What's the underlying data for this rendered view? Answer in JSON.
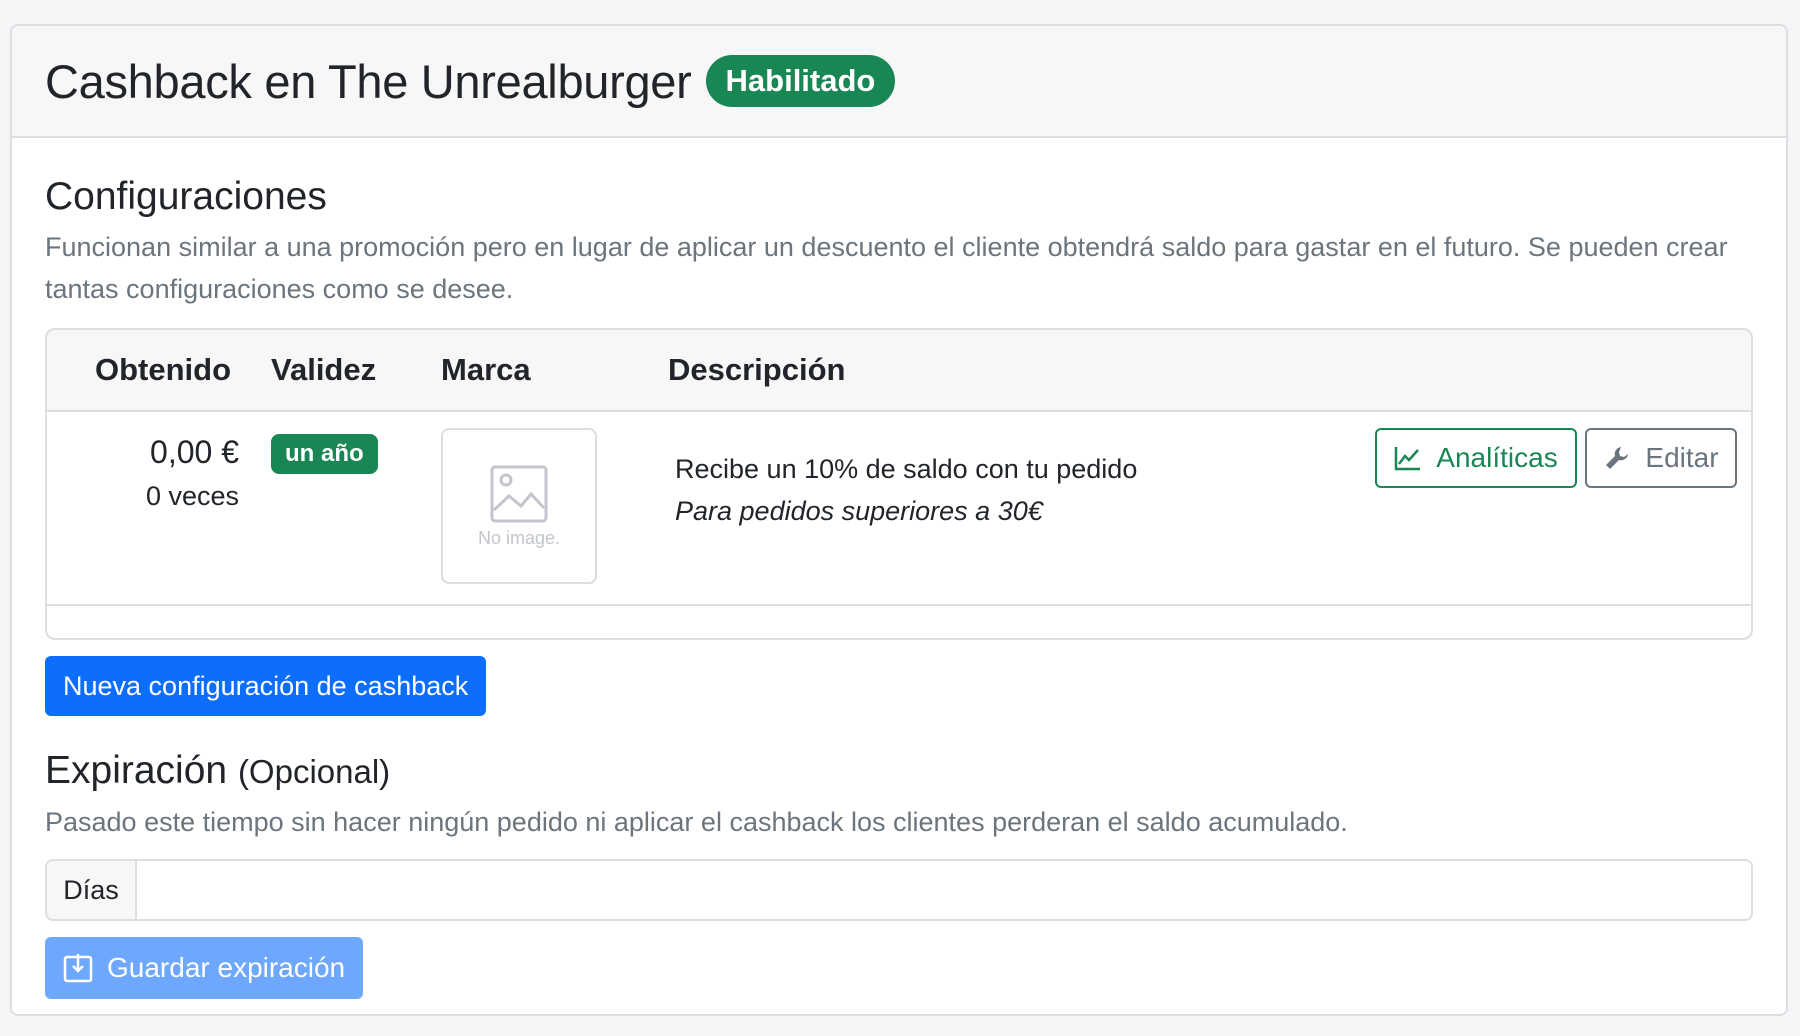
{
  "header": {
    "title": "Cashback en The Unrealburger",
    "status_badge": "Habilitado"
  },
  "configurations": {
    "title": "Configuraciones",
    "description": "Funcionan similar a una promoción pero en lugar de aplicar un descuento el cliente obtendrá saldo para gastar en el futuro. Se pueden crear tantas configuraciones como se desee.",
    "columns": [
      "Obtenido",
      "Validez",
      "Marca",
      "Descripción"
    ],
    "rows": [
      {
        "amount": "0,00 €",
        "times": "0 veces",
        "validity": "un año",
        "brand_image_placeholder": "No image.",
        "description": "Recibe un 10% de saldo con tu pedido",
        "note": "Para pedidos superiores a 30€",
        "analytics_label": "Analíticas",
        "edit_label": "Editar"
      }
    ],
    "new_button": "Nueva configuración de cashback"
  },
  "expiration": {
    "title": "Expiración",
    "optional": "(Opcional)",
    "description": "Pasado este tiempo sin hacer ningún pedido ni aplicar el cashback los clientes perderan el saldo acumulado.",
    "input_label": "Días",
    "input_value": "",
    "save_button": "Guardar expiración"
  },
  "colors": {
    "success": "#198754",
    "primary": "#0d6efd",
    "primary_disabled": "#6ea8fe",
    "secondary": "#6c757d"
  }
}
